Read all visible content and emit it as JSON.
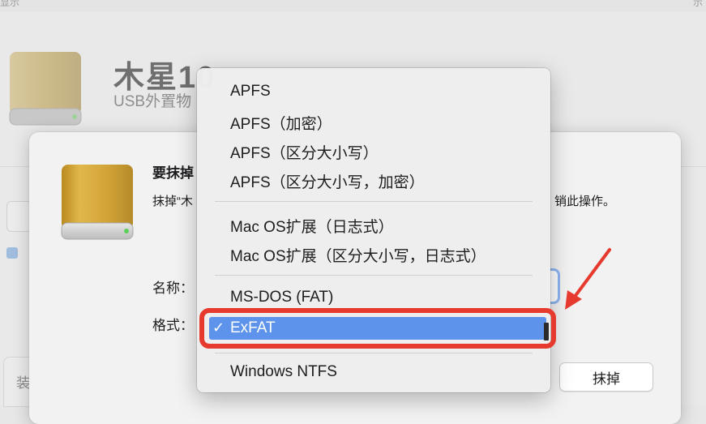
{
  "background": {
    "top_left_fragment": "显示",
    "top_right_fragment": "示",
    "drive_name": "木星10",
    "drive_subtitle": "USB外置物",
    "bottom_left_fragment": "装"
  },
  "sheet": {
    "title": "要抹掉",
    "description_start": "抹掉“木",
    "description_end": "销此操作。",
    "name_label": "名称：",
    "format_label": "格式：",
    "erase_button": "抹掉"
  },
  "format_menu": {
    "items": [
      {
        "label": "APFS"
      },
      {
        "label": "APFS（加密）"
      },
      {
        "label": "APFS（区分大小写）"
      },
      {
        "label": "APFS（区分大小写，加密）"
      },
      {
        "label": "Mac OS扩展（日志式）"
      },
      {
        "label": "Mac OS扩展（区分大小写，日志式）"
      },
      {
        "label": "MS-DOS (FAT)"
      },
      {
        "label": "ExFAT"
      },
      {
        "label": "Windows NTFS"
      }
    ],
    "selected": "ExFAT",
    "check_icon": "✓"
  },
  "colors": {
    "selection": "#5d93ea",
    "annotation_red": "#e63a2e",
    "drive_gold": "#c9a033"
  }
}
